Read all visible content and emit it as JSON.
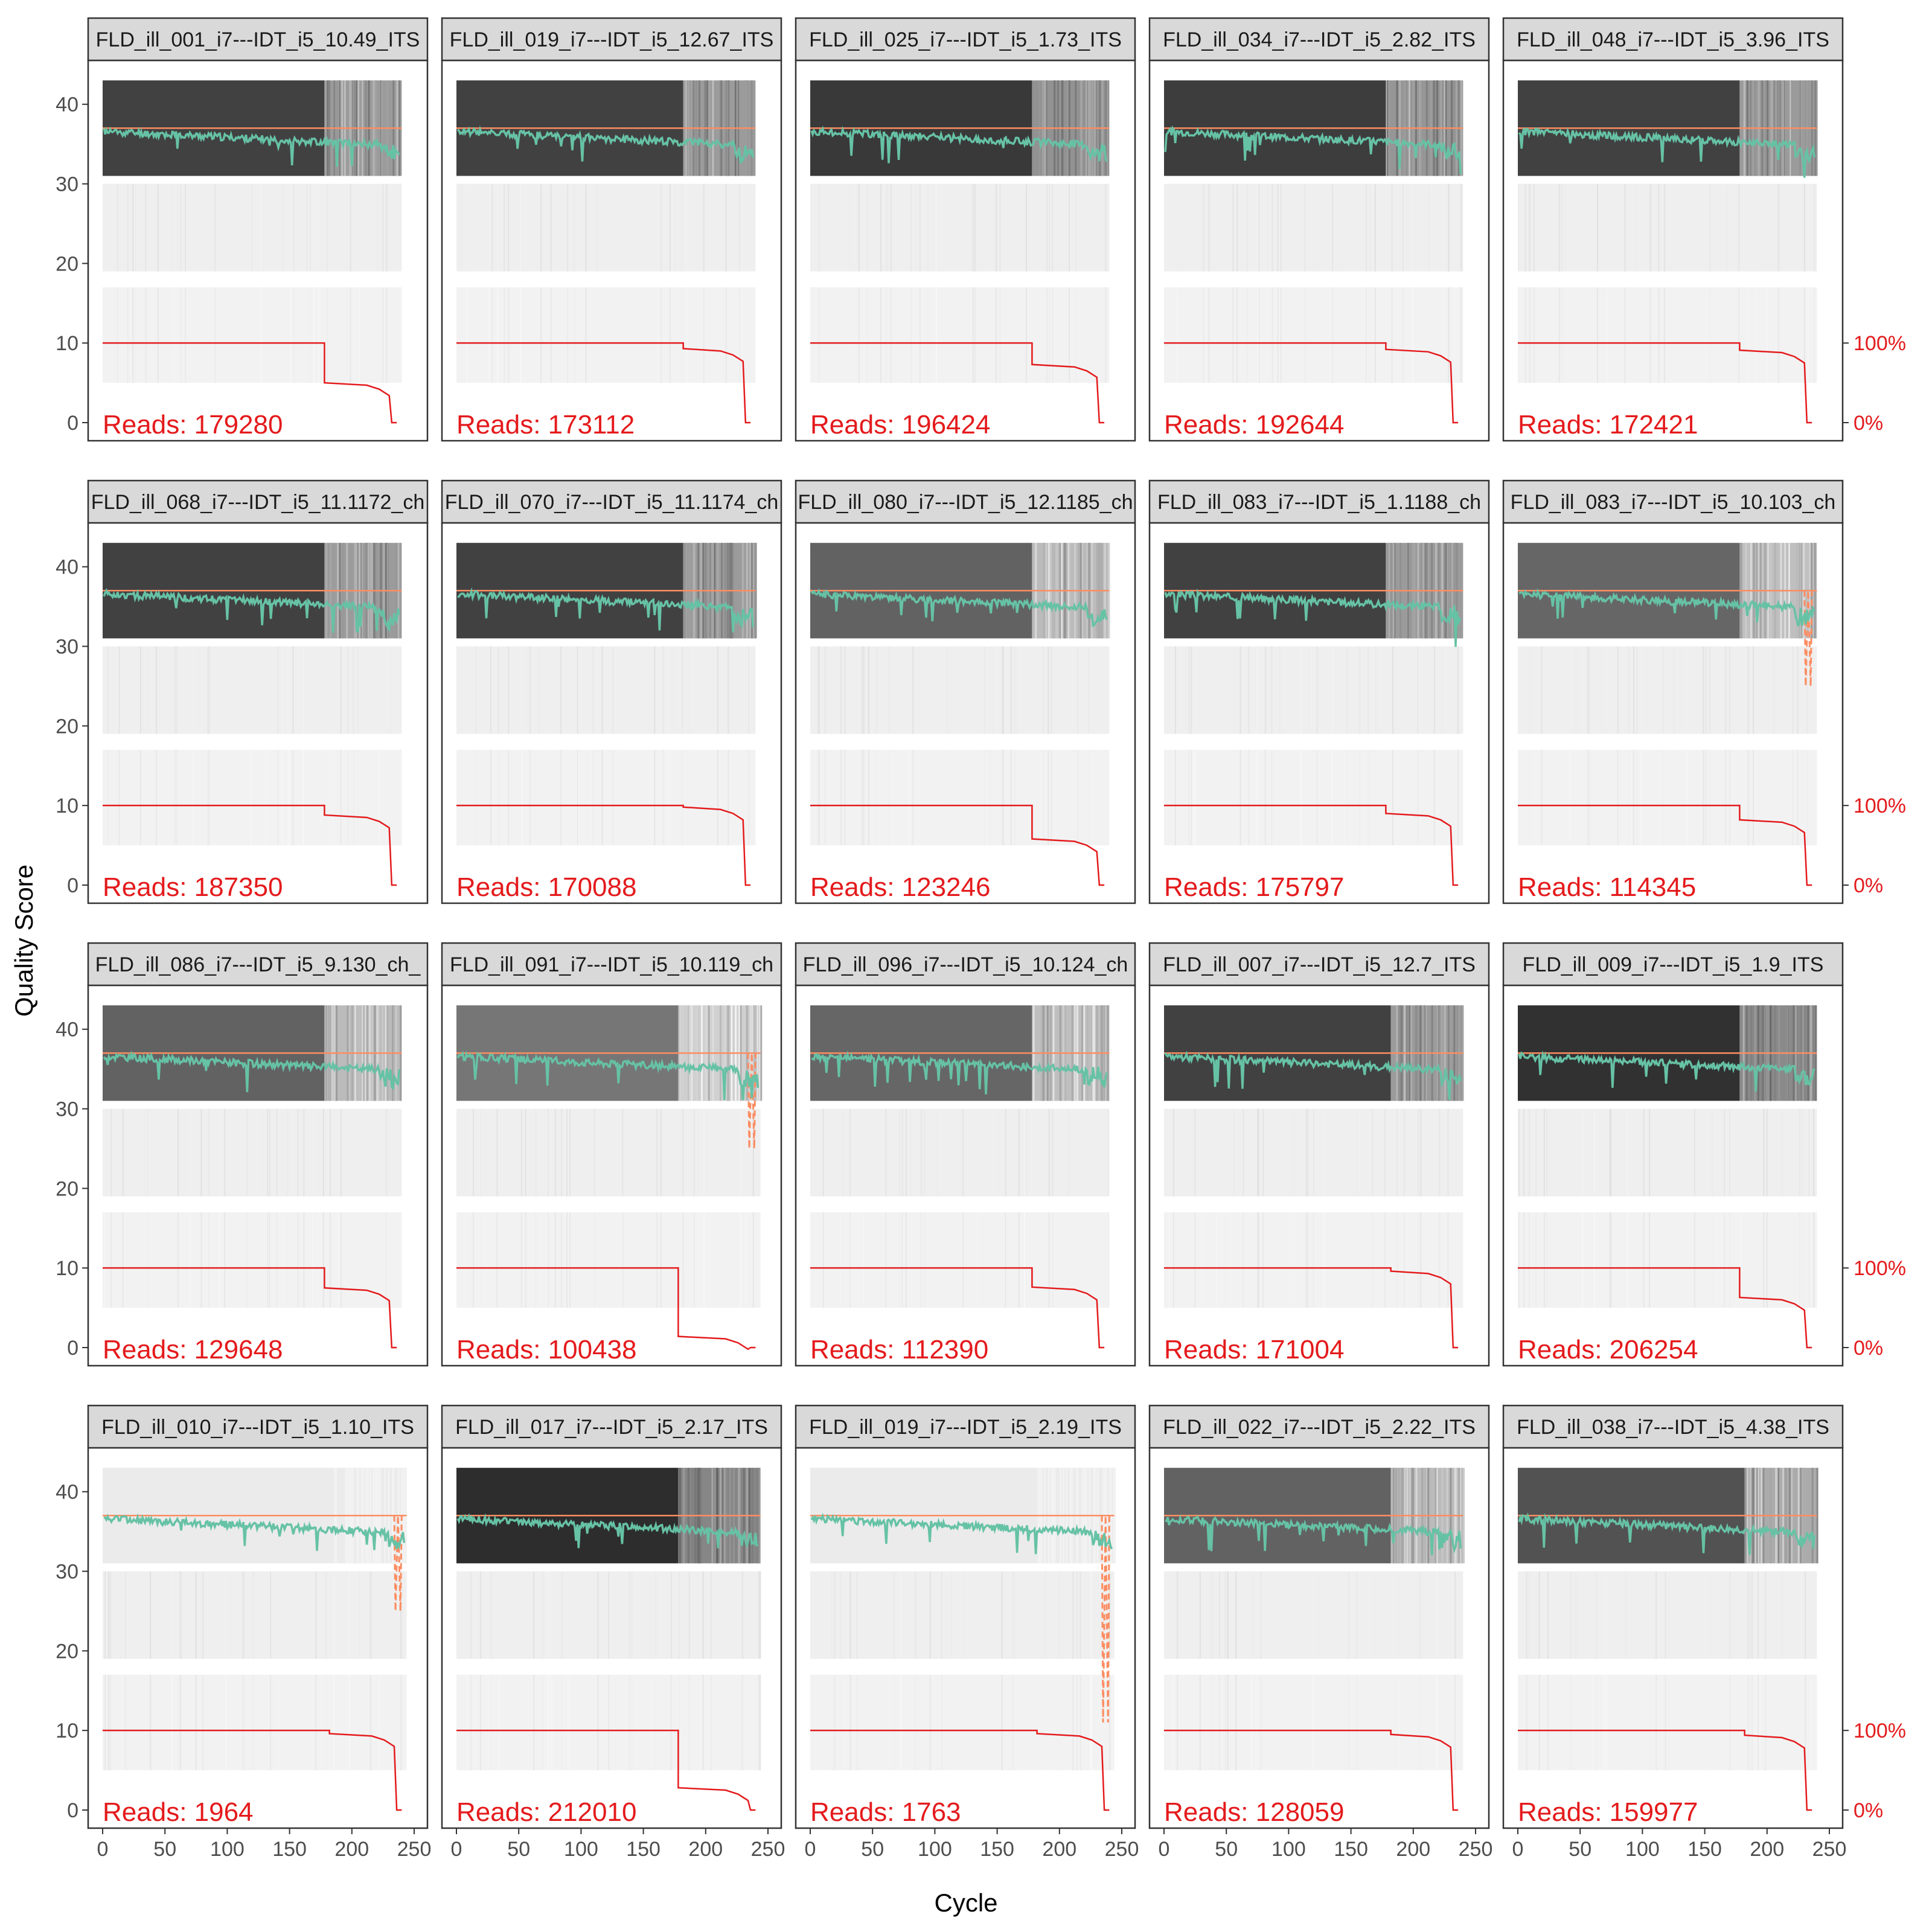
{
  "figure": {
    "ylabel": "Quality Score",
    "xlabel": "Cycle"
  },
  "chart_data": {
    "type": "line",
    "facet_layout": "5 columns x 4 rows",
    "xlim": [
      0,
      250
    ],
    "ylim": [
      0,
      44
    ],
    "x_ticks": [
      "0",
      "50",
      "100",
      "150",
      "200",
      "250"
    ],
    "y_ticks": [
      "0",
      "10",
      "20",
      "30",
      "40"
    ],
    "right_axis_ticks": [
      "100%",
      "0%"
    ],
    "reads_prefix": "Reads:  ",
    "grid": false,
    "legend": "none",
    "colors": {
      "mean_quality": "#66c2a5",
      "reference_line": "#fc8d62",
      "quantile_dashed": "#fc8d62",
      "read_fraction": "#e41a1c",
      "reads_text": "#e41a1c",
      "strip_bg": "#d9d9d9",
      "panel_border": "#333333"
    },
    "panels": [
      {
        "title": "FLD_ill_001_i7---IDT_i5_10.49_ITS",
        "reads": "179280",
        "density": 0.88,
        "step1": 178,
        "level2": 5.0,
        "drop": 232,
        "end": 236,
        "len": 240,
        "dip": 0
      },
      {
        "title": "FLD_ill_019_i7---IDT_i5_12.67_ITS",
        "reads": "173112",
        "density": 0.88,
        "step1": 182,
        "level2": 9.3,
        "drop": 232,
        "end": 236,
        "len": 240,
        "dip": 0
      },
      {
        "title": "FLD_ill_025_i7---IDT_i5_1.73_ITS",
        "reads": "196424",
        "density": 0.92,
        "step1": 178,
        "level2": 7.3,
        "drop": 232,
        "end": 236,
        "len": 240,
        "dip": 0
      },
      {
        "title": "FLD_ill_034_i7---IDT_i5_2.82_ITS",
        "reads": "192644",
        "density": 0.9,
        "step1": 178,
        "level2": 9.2,
        "drop": 232,
        "end": 236,
        "len": 240,
        "dip": 0
      },
      {
        "title": "FLD_ill_048_i7---IDT_i5_3.96_ITS",
        "reads": "172421",
        "density": 0.88,
        "step1": 178,
        "level2": 9.1,
        "drop": 232,
        "end": 236,
        "len": 240,
        "dip": 0
      },
      {
        "title": "FLD_ill_068_i7---IDT_i5_11.1172_ch",
        "reads": "187350",
        "density": 0.88,
        "step1": 178,
        "level2": 8.8,
        "drop": 232,
        "end": 236,
        "len": 240,
        "dip": 0
      },
      {
        "title": "FLD_ill_070_i7---IDT_i5_11.1174_ch",
        "reads": "170088",
        "density": 0.88,
        "step1": 182,
        "level2": 9.8,
        "drop": 232,
        "end": 236,
        "len": 240,
        "dip": 0
      },
      {
        "title": "FLD_ill_080_i7---IDT_i5_12.1185_ch",
        "reads": "123246",
        "density": 0.72,
        "step1": 178,
        "level2": 5.8,
        "drop": 232,
        "end": 236,
        "len": 240,
        "dip": 0
      },
      {
        "title": "FLD_ill_083_i7---IDT_i5_1.1188_ch",
        "reads": "175797",
        "density": 0.88,
        "step1": 178,
        "level2": 9.0,
        "drop": 232,
        "end": 236,
        "len": 240,
        "dip": 0
      },
      {
        "title": "FLD_ill_083_i7---IDT_i5_10.103_ch",
        "reads": "114345",
        "density": 0.7,
        "step1": 178,
        "level2": 8.2,
        "drop": 232,
        "end": 236,
        "len": 240,
        "dip": 25
      },
      {
        "title": "FLD_ill_086_i7---IDT_i5_9.130_ch_",
        "reads": "129648",
        "density": 0.72,
        "step1": 178,
        "level2": 7.5,
        "drop": 232,
        "end": 236,
        "len": 240,
        "dip": 0
      },
      {
        "title": "FLD_ill_091_i7---IDT_i5_10.119_ch",
        "reads": "100438",
        "density": 0.62,
        "step1": 178,
        "level2": 1.4,
        "drop": 236,
        "end": 240,
        "len": 244,
        "dip": 25
      },
      {
        "title": "FLD_ill_096_i7---IDT_i5_10.124_ch",
        "reads": "112390",
        "density": 0.7,
        "step1": 178,
        "level2": 7.6,
        "drop": 232,
        "end": 236,
        "len": 240,
        "dip": 0
      },
      {
        "title": "FLD_ill_007_i7---IDT_i5_12.7_ITS",
        "reads": "171004",
        "density": 0.88,
        "step1": 182,
        "level2": 9.6,
        "drop": 232,
        "end": 236,
        "len": 240,
        "dip": 0
      },
      {
        "title": "FLD_ill_009_i7---IDT_i5_1.9_ITS",
        "reads": "206254",
        "density": 0.96,
        "step1": 178,
        "level2": 6.3,
        "drop": 232,
        "end": 236,
        "len": 240,
        "dip": 0
      },
      {
        "title": "FLD_ill_010_i7---IDT_i5_1.10_ITS",
        "reads": "1964",
        "density": 0.05,
        "step1": 182,
        "level2": 9.6,
        "drop": 236,
        "end": 240,
        "len": 244,
        "dip": 25
      },
      {
        "title": "FLD_ill_017_i7---IDT_i5_2.17_ITS",
        "reads": "212010",
        "density": 0.98,
        "step1": 178,
        "level2": 2.8,
        "drop": 236,
        "end": 240,
        "len": 244,
        "dip": 0
      },
      {
        "title": "FLD_ill_019_i7---IDT_i5_2.19_ITS",
        "reads": "1763",
        "density": 0.05,
        "step1": 182,
        "level2": 9.6,
        "drop": 236,
        "end": 240,
        "len": 244,
        "dip": 11
      },
      {
        "title": "FLD_ill_022_i7---IDT_i5_2.22_ITS",
        "reads": "128059",
        "density": 0.72,
        "step1": 182,
        "level2": 9.5,
        "drop": 232,
        "end": 236,
        "len": 240,
        "dip": 0
      },
      {
        "title": "FLD_ill_038_i7---IDT_i5_4.38_ITS",
        "reads": "159977",
        "density": 0.8,
        "step1": 182,
        "level2": 9.4,
        "drop": 232,
        "end": 236,
        "len": 240,
        "dip": 0
      }
    ]
  }
}
